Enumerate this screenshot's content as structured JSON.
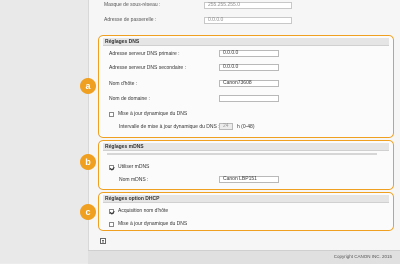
{
  "top_fields": {
    "subnet_label": "Masque de sous-réseau :",
    "subnet_value": "255.255.255.0",
    "gateway_label": "Adresse de passerelle :",
    "gateway_value": "0.0.0.0"
  },
  "dns": {
    "title": "Réglages DNS",
    "primary_label": "Adresse serveur DNS primaire :",
    "primary_value": "0.0.0.0",
    "secondary_label": "Adresse serveur DNS secondaire :",
    "secondary_value": "0.0.0.0",
    "hostname_label": "Nom d'hôte :",
    "hostname_value": "Canon73608",
    "domain_label": "Nom de domaine :",
    "domain_value": "",
    "dynamic_update_label": "Mise à jour dynamique du DNS",
    "dynamic_update_checked": false,
    "interval_label": "Intervalle de mise à jour dynamique du DNS :",
    "interval_value": "24",
    "interval_unit": "h (0-48)"
  },
  "mdns": {
    "title": "Réglages mDNS",
    "use_label": "Utiliser mDNS",
    "use_checked": true,
    "name_label": "Nom mDNS :",
    "name_value": "Canon LBP151"
  },
  "dhcp": {
    "title": "Réglages option DHCP",
    "acquire_host_label": "Acquisition nom d'hôte",
    "acquire_host_checked": true,
    "dynamic_update_label": "Mise à jour dynamique du DNS",
    "dynamic_update_checked": false
  },
  "badges": {
    "a": "a",
    "b": "b",
    "c": "c"
  },
  "footer": {
    "copyright": "Copyright CANON INC. 2015",
    "icon": "menu-list-icon"
  },
  "colors": {
    "accent": "#f0a020"
  }
}
